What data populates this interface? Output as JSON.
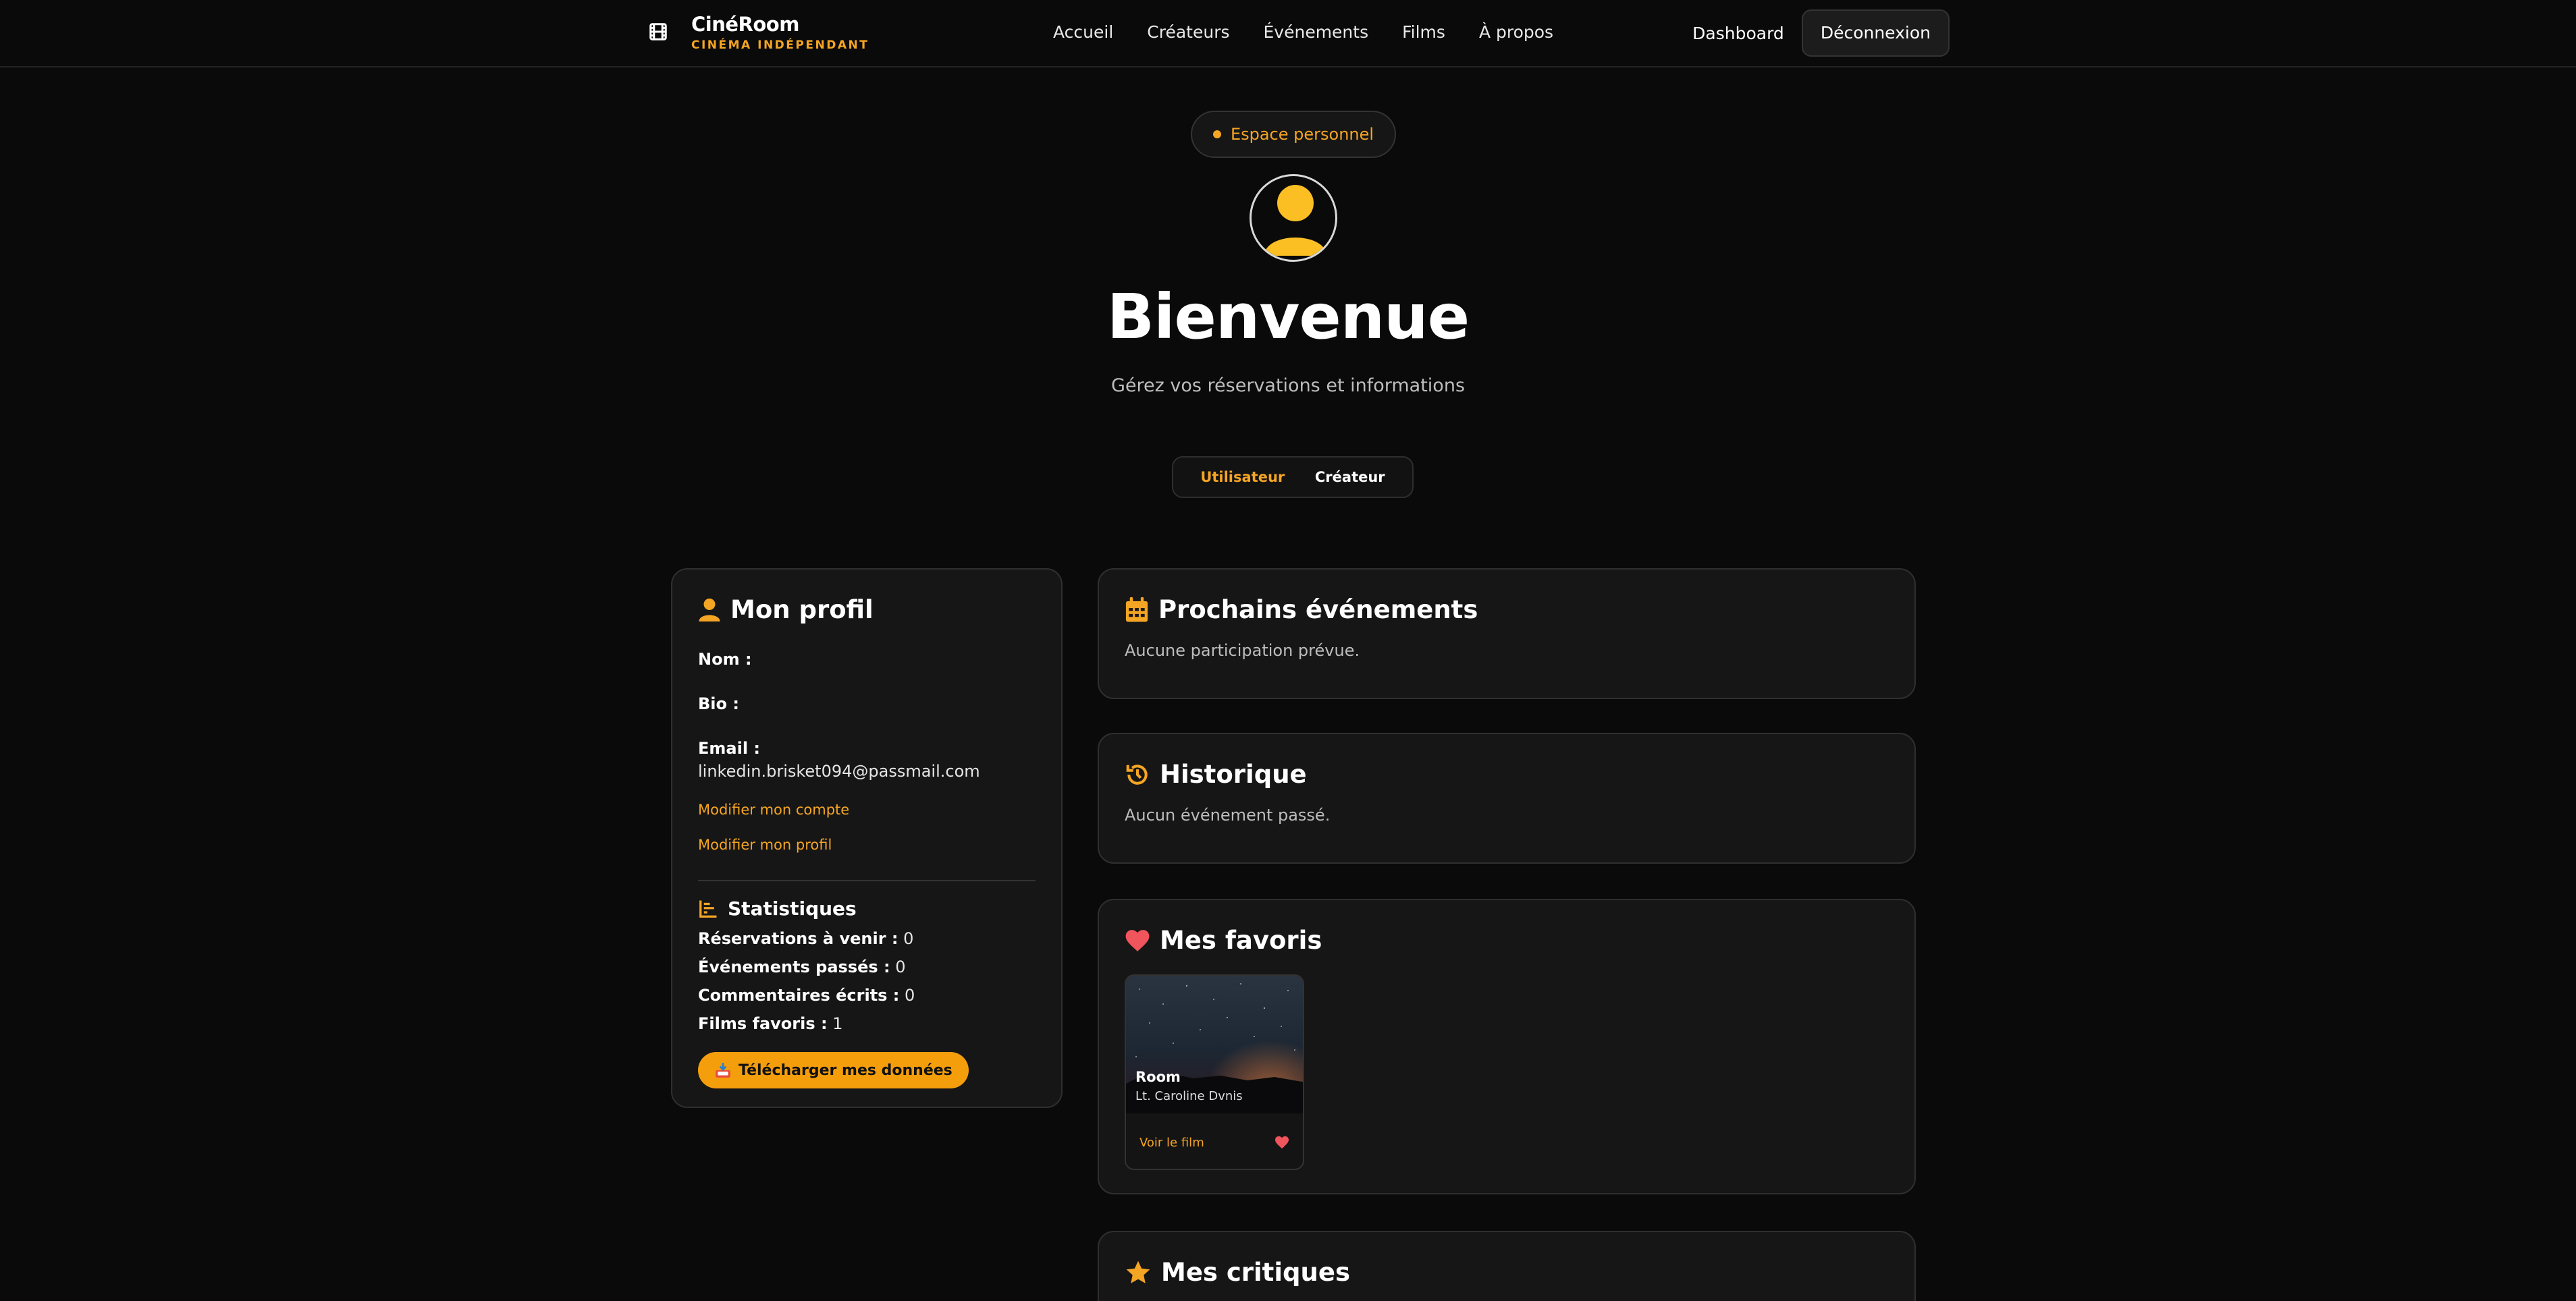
{
  "nav": {
    "brand_name": "CinéRoom",
    "brand_sub": "CINÉMA INDÉPENDANT",
    "links": [
      "Accueil",
      "Créateurs",
      "Événements",
      "Films",
      "À propos"
    ],
    "dashboard": "Dashboard",
    "logout": "Déconnexion"
  },
  "hero": {
    "pill": "Espace personnel",
    "title": "Bienvenue",
    "subtitle": "Gérez vos réservations et informations",
    "tabs": [
      "Utilisateur",
      "Créateur"
    ]
  },
  "profile": {
    "title": "Mon profil",
    "name_label": "Nom :",
    "name_value": "",
    "bio_label": "Bio :",
    "bio_value": "",
    "email_label": "Email :",
    "email_value": "linkedin.brisket094@passmail.com",
    "edit_account": "Modifier mon compte",
    "edit_profile": "Modifier mon profil",
    "stats_title": "Statistiques",
    "stats": [
      {
        "label": "Réservations à venir :",
        "value": "0"
      },
      {
        "label": "Événements passés :",
        "value": "0"
      },
      {
        "label": "Commentaires écrits :",
        "value": "0"
      },
      {
        "label": "Films favoris :",
        "value": "1"
      }
    ],
    "download": "Télécharger mes données"
  },
  "events": {
    "title": "Prochains événements",
    "empty": "Aucune participation prévue."
  },
  "history": {
    "title": "Historique",
    "empty": "Aucun événement passé."
  },
  "favorites": {
    "title": "Mes favoris",
    "items": [
      {
        "title": "Room",
        "author": "Lt. Caroline Dvnis",
        "link": "Voir le film"
      }
    ]
  },
  "reviews": {
    "title": "Mes critiques"
  },
  "colors": {
    "accent": "#f5a524",
    "heart": "#f0545c",
    "background": "#0a0a0a",
    "card": "#161616"
  }
}
